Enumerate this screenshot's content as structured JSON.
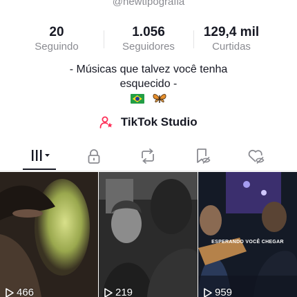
{
  "profile": {
    "handle": "@newtipografia",
    "bio_line1": "- Músicas que talvez você tenha",
    "bio_line2": "esquecido -"
  },
  "stats": [
    {
      "value": "20",
      "label": "Seguindo"
    },
    {
      "value": "1.056",
      "label": "Seguidores"
    },
    {
      "value": "129,4 mil",
      "label": "Curtidas"
    }
  ],
  "studio": {
    "label": "TikTok Studio",
    "icon": "person-star-icon"
  },
  "tabs": [
    {
      "icon": "grid-dropdown-icon",
      "active": true
    },
    {
      "icon": "lock-icon",
      "active": false
    },
    {
      "icon": "repost-icon",
      "active": false
    },
    {
      "icon": "bookmark-eye-icon",
      "active": false
    },
    {
      "icon": "heart-eye-icon",
      "active": false
    }
  ],
  "videos": [
    {
      "views": "466"
    },
    {
      "views": "219"
    },
    {
      "views": "959",
      "caption": "ESPERANDO VOCÊ CHEGAR"
    }
  ],
  "colors": {
    "accent": "#fe2c55",
    "text": "#161823",
    "muted": "#8a8b91"
  }
}
